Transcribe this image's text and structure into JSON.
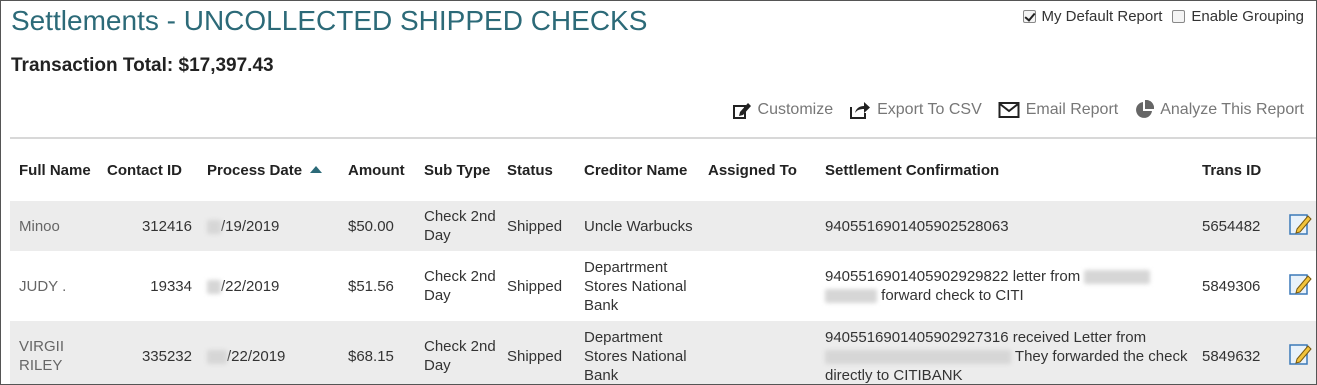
{
  "header": {
    "title": "Settlements - UNCOLLECTED SHIPPED CHECKS",
    "transaction_total": "Transaction Total: $17,397.43"
  },
  "options": {
    "my_default_report": {
      "label": "My Default Report",
      "checked": true
    },
    "enable_grouping": {
      "label": "Enable Grouping",
      "checked": false
    }
  },
  "toolbar": {
    "customize": "Customize",
    "export_csv": "Export To CSV",
    "email_report": "Email Report",
    "analyze": "Analyze This Report"
  },
  "table": {
    "columns": [
      "Full Name",
      "Contact ID",
      "Process Date",
      "Amount",
      "Sub Type",
      "Status",
      "Creditor Name",
      "Assigned To",
      "Settlement Confirmation",
      "Trans ID"
    ],
    "sorted_column": "Process Date",
    "rows": [
      {
        "full_name": "Minoo",
        "contact_id": "312416",
        "process_date": "/19/2019",
        "amount": "$50.00",
        "sub_type": "Check 2nd Day",
        "status": "Shipped",
        "creditor_name": "Uncle Warbucks",
        "assigned_to": "",
        "confirmation": "9405516901405902528063",
        "trans_id": "5654482"
      },
      {
        "full_name": "JUDY .",
        "contact_id": "19334",
        "process_date": "/22/2019",
        "amount": "$51.56",
        "sub_type": "Check 2nd Day",
        "status": "Shipped",
        "creditor_name": "Departrment Stores National Bank",
        "assigned_to": "",
        "confirmation": "9405516901405902929822 letter from",
        "confirmation_tail": "forward check to CITI",
        "trans_id": "5849306"
      },
      {
        "full_name": "VIRGII RILEY",
        "contact_id": "335232",
        "process_date": "/22/2019",
        "amount": "$68.15",
        "sub_type": "Check 2nd Day",
        "status": "Shipped",
        "creditor_name": "Department Stores National Bank",
        "assigned_to": "",
        "confirmation": "9405516901405902927316 received Letter from",
        "confirmation_tail": "They forwarded the check directly to CITIBANK",
        "trans_id": "5849632"
      }
    ]
  },
  "colors": {
    "title": "#2c6a78",
    "row_alt": "#ececec"
  }
}
